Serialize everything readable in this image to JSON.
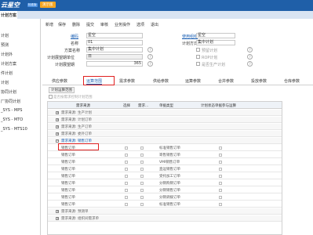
{
  "app": {
    "brand": "云星空",
    "badge": "标准版",
    "demo": "演示版"
  },
  "active_tab": "计划方案",
  "sidebar": {
    "items": [
      "计划",
      "预测",
      "计划外",
      "计划方案",
      "件计划",
      "计划",
      "协同计划",
      "厂协同计划",
      "_SYS - MPS",
      "_SYS - MTO",
      "_SYS - MTS10"
    ]
  },
  "toolbar": {
    "items": [
      "新增",
      "保存",
      "删除",
      "提交",
      "审核",
      "业务操作",
      "选项",
      "退出"
    ]
  },
  "form": {
    "number_label": "编码",
    "number_value": "星空",
    "name_label": "名称",
    "name_value": "01",
    "scheme_label": "方案名称",
    "scheme_value": "集中计划",
    "unit_label": "计划展望期单位",
    "unit_value": "日",
    "horizon_label": "计划展望期",
    "horizon_value": "365",
    "org_label": "使用组织",
    "org_value": "星空",
    "mode_label": "计划方式",
    "mode_value": "集中计划",
    "chk1": "预留计划",
    "chk2": "ROP计划",
    "chk3": "是否生产计划"
  },
  "param_tabs": [
    "供应参数",
    "运算范围",
    "需求参数",
    "供给参数",
    "运算参数",
    "合并参数",
    "投放参数",
    "仓库参数"
  ],
  "subtab": "计划运算范围",
  "hint": "是否按需求控制计划范围",
  "grid": {
    "headers": [
      "需求来源",
      "选择",
      "需求...",
      "单据类型",
      "计划状态单据参与运算"
    ],
    "rows": [
      {
        "type": "group",
        "text": "需求来源: 生产计划"
      },
      {
        "type": "group",
        "text": "需求来源: 计划订单"
      },
      {
        "type": "group",
        "text": "需求来源: 生产订单"
      },
      {
        "type": "group",
        "text": "需求来源: 委外订单"
      },
      {
        "type": "group",
        "text": "需求来源: 销售订单",
        "selected": true
      },
      {
        "type": "data",
        "source": "销售订单",
        "doctype": "标准销售订单"
      },
      {
        "type": "data",
        "source": "销售订单",
        "doctype": "寄售销售订单"
      },
      {
        "type": "data",
        "source": "销售订单",
        "doctype": "VMI销售订单"
      },
      {
        "type": "data",
        "source": "销售订单",
        "doctype": "直运销售订单"
      },
      {
        "type": "data",
        "source": "销售订单",
        "doctype": "受托加工订单"
      },
      {
        "type": "data",
        "source": "销售订单",
        "doctype": "分销购销订单"
      },
      {
        "type": "data",
        "source": "销售订单",
        "doctype": "分销销售订单"
      },
      {
        "type": "data",
        "source": "销售订单",
        "doctype": "分销调拨订单"
      },
      {
        "type": "data",
        "source": "销售订单",
        "doctype": "标准销售订单"
      },
      {
        "type": "group",
        "text": "需求来源: 预测单"
      },
      {
        "type": "group",
        "text": "需求来源: 组织间需求单"
      }
    ]
  }
}
